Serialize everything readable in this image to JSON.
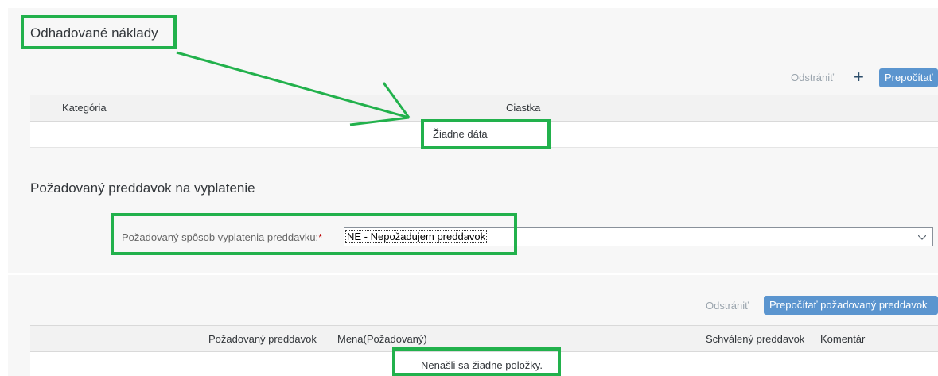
{
  "costs": {
    "title": "Odhadované náklady",
    "toolbar": {
      "remove_label": "Odstrániť",
      "add_icon": "plus-icon",
      "recalculate_label": "Prepočítať"
    },
    "columns": [
      "Kategória",
      "Ciastka"
    ],
    "empty_text": "Žiadne dáta"
  },
  "advance": {
    "title": "Požadovaný preddavok na vyplatenie",
    "field": {
      "label": "Požadovaný spôsob vyplatenia preddavku:",
      "required_mark": "*",
      "value": "NE - Nepožadujem preddavok",
      "dropdown_icon": "chevron-down-icon"
    }
  },
  "advances_table": {
    "toolbar": {
      "remove_label": "Odstrániť",
      "recalculate_label": "Prepočítať požadovaný preddavok"
    },
    "columns": [
      "Požadovaný preddavok",
      "Mena(Požadovaný)",
      "Schválený preddavok",
      "Komentár"
    ],
    "empty_text": "Nenašli sa žiadne položky."
  },
  "colors": {
    "annotation": "#22b14c",
    "primary_button": "#5b95cf",
    "required": "#bb0000"
  }
}
